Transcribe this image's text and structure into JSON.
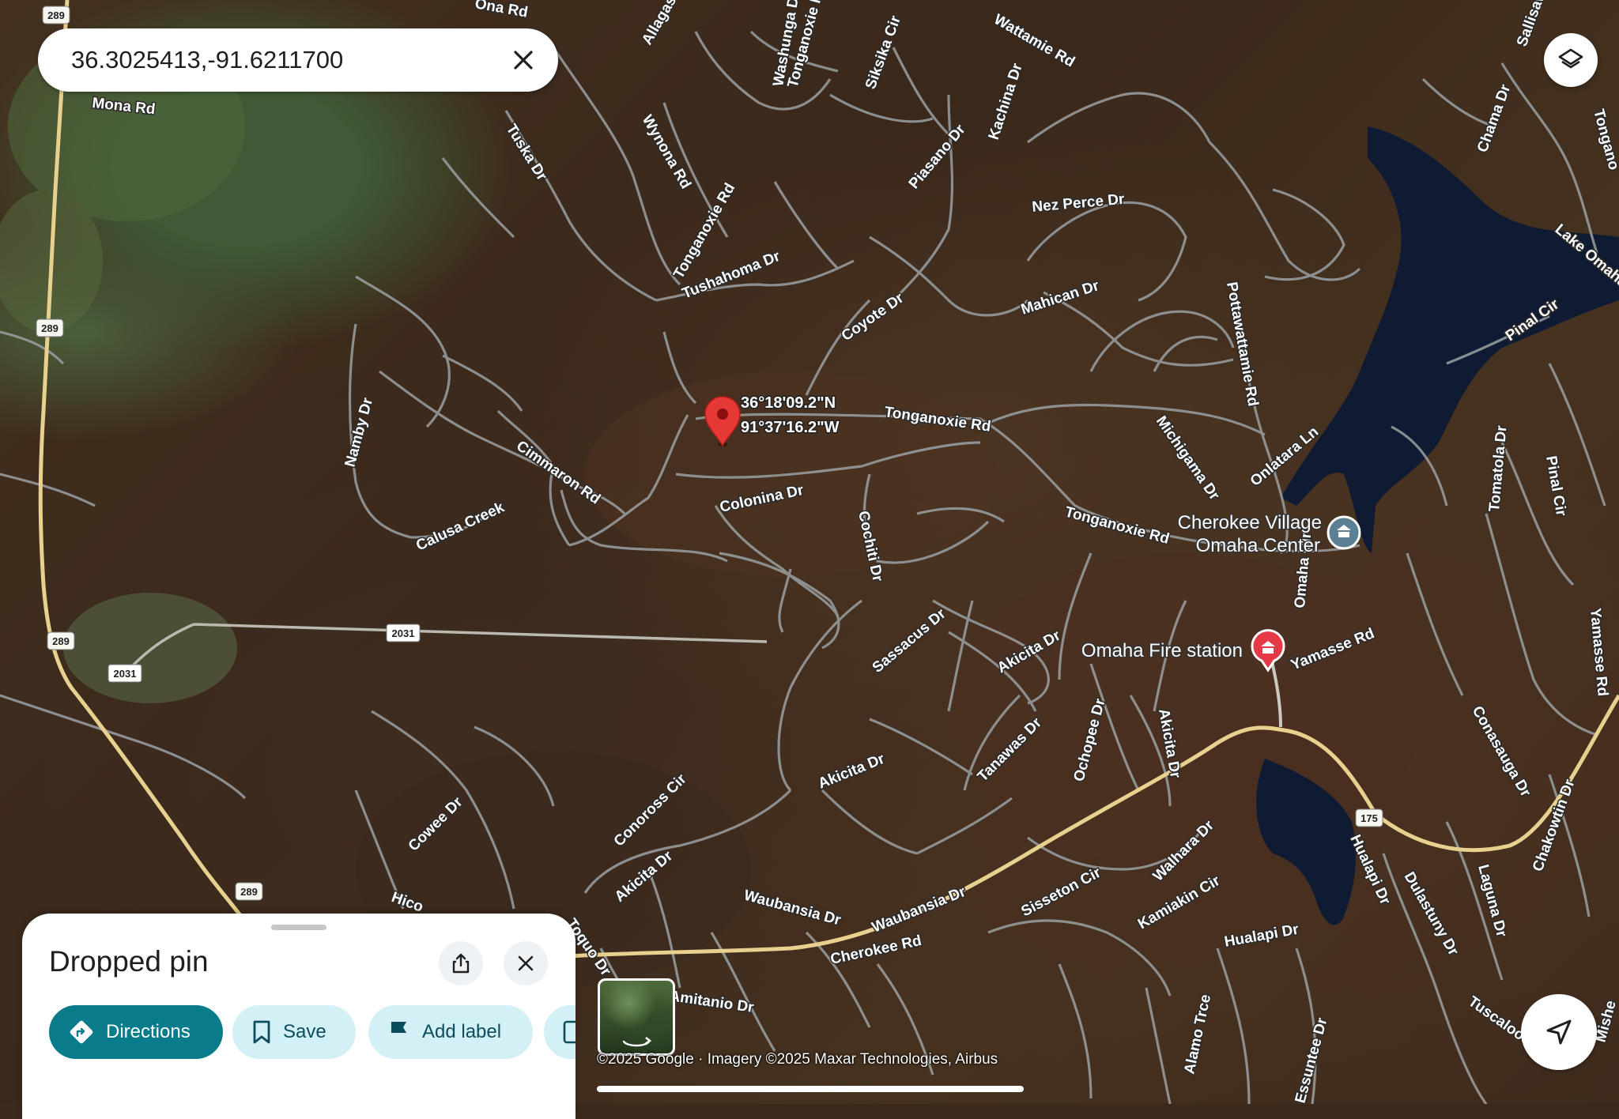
{
  "search": {
    "query": "36.3025413,-91.6211700"
  },
  "pin": {
    "lat_dms": "36°18'09.2\"N",
    "lng_dms": "91°37'16.2\"W"
  },
  "map": {
    "attribution": "©2025 Google · Imagery ©2025 Maxar Technologies, Airbus",
    "roads": [
      "Tonganoxie Rd",
      "Tonganoxie Rd",
      "Tonganoxie Rd",
      "Tonganoxie Rd",
      "Tushahoma Dr",
      "Coyote Dr",
      "Cimmaron Rd",
      "Calusa Creek",
      "Namby Dr",
      "Colonina Dr",
      "Cochiti Dr",
      "Michigama Dr",
      "Pottawattamie Rd",
      "Onlatara Ln",
      "Mahican Dr",
      "Nez Perce Dr",
      "Piasano Dr",
      "Kachina Dr",
      "Siksika Cir",
      "Washunga Dr",
      "Wynona Rd",
      "Tuska Dr",
      "Allagash",
      "Wattamie Rd",
      "Lake Omaha",
      "Pinal Cir",
      "Pinal Cir",
      "Chama Dr",
      "Tomatola Dr",
      "Omaha Cir",
      "Yamasse Rd",
      "Yamasse Rd",
      "Sassacus Dr",
      "Akicita Dr",
      "Akicita Dr",
      "Akicita Dr",
      "Akicita Dr",
      "Tanawas Dr",
      "Ochopee Dr",
      "Conoross Cir",
      "Cowee Dr",
      "Waubansia Dr",
      "Waubansia Dr",
      "Cherokee Rd",
      "Sisseton Cir",
      "Walhara Dr",
      "Kamiakin Cir",
      "Hualapi Dr",
      "Hualapi Dr",
      "Dulastuny Dr",
      "Laguna Dr",
      "Chakowtin Dr",
      "Conasauga Dr",
      "Tuscaloosa",
      "Alamo Trce",
      "Essuntee Dr",
      "Amitanio Dr",
      "Toquo Dr",
      "Hico",
      "Sallisaw",
      "Tongano",
      "Mishe",
      "Ona Rd",
      "Mona Rd"
    ],
    "route_shields": [
      "289",
      "289",
      "289",
      "289",
      "289",
      "2031",
      "2031",
      "175"
    ],
    "places": [
      {
        "name_line1": "Cherokee Village",
        "name_line2": "Omaha Center"
      },
      {
        "name": "Omaha Fire station"
      }
    ]
  },
  "sheet": {
    "title": "Dropped pin",
    "chips": {
      "directions": "Directions",
      "save": "Save",
      "add_label": "Add label"
    }
  },
  "colors": {
    "accent": "#097c8c",
    "tonal": "#d4f0f7",
    "pin": "#e53935",
    "fire_station": "#e53945",
    "civic": "#5b7f95"
  }
}
